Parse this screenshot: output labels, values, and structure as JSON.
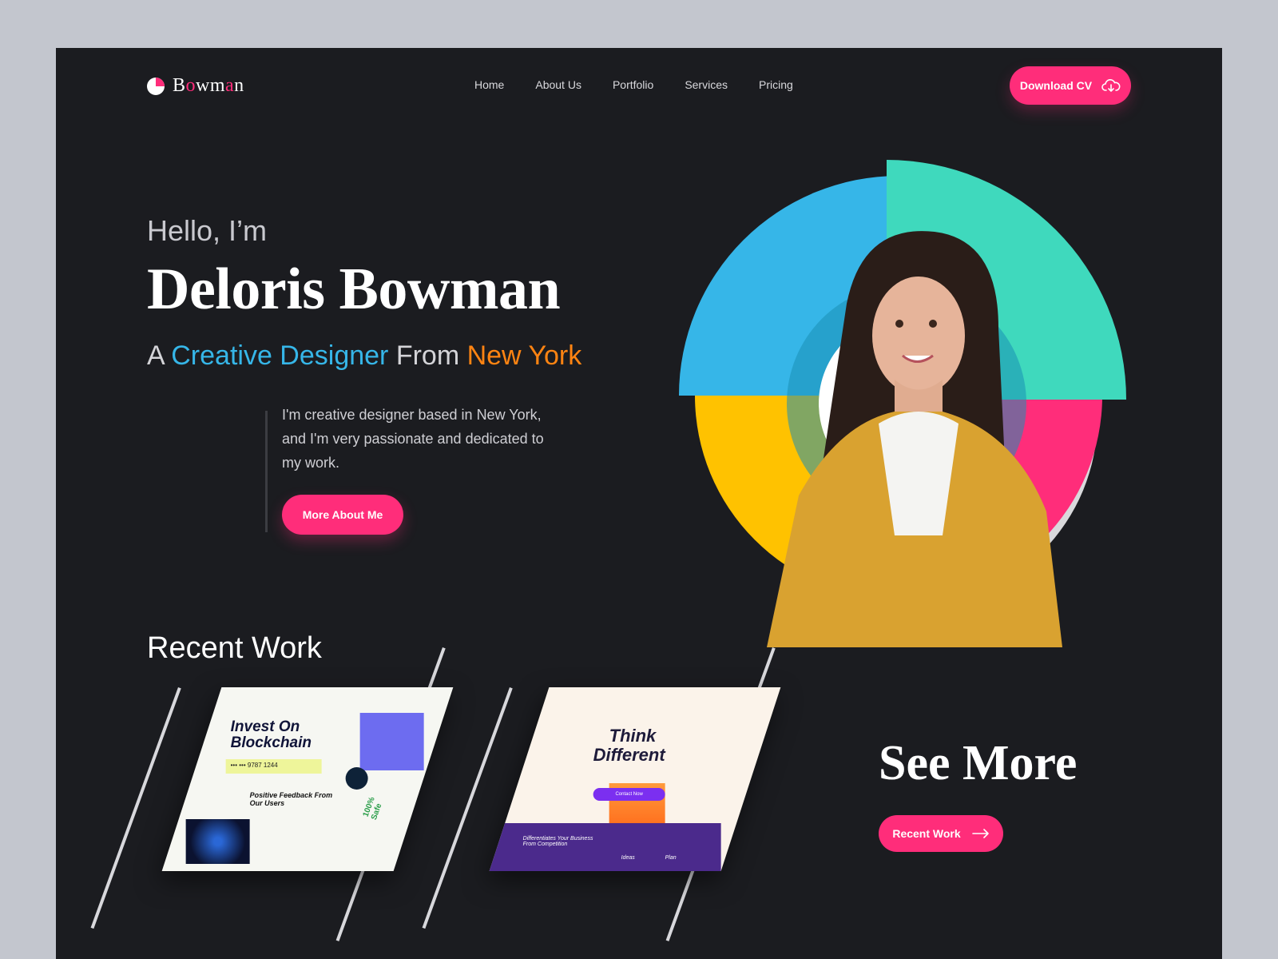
{
  "brand": {
    "logo_prefix": "B",
    "logo_o": "o",
    "logo_mid": "wm",
    "logo_a": "a",
    "logo_suffix": "n"
  },
  "nav": {
    "items": [
      "Home",
      "About Us",
      "Portfolio",
      "Services",
      "Pricing"
    ]
  },
  "header": {
    "download_label": "Download CV"
  },
  "hero": {
    "greeting": "Hello, I’m",
    "name": "Deloris Bowman",
    "tag_a": "A ",
    "tag_role": "Creative Designer",
    "tag_from": " From ",
    "tag_city": "New York",
    "intro": "I'm creative designer based in New York, and I'm very passionate and dedicated to my work.",
    "more_label": "More About Me"
  },
  "recent": {
    "title": "Recent Work",
    "card1": {
      "headline": "Invest On Blockchain",
      "code": "••• ••• 9787 1244",
      "feedback": "Positive Feedback From Our Users",
      "safe": "100% Safe"
    },
    "card2": {
      "headline_1": "Think",
      "headline_2": "Different",
      "cta": "Contact Now",
      "footer": "Differentiates Your Business From Competition",
      "tag_ideas": "Ideas",
      "tag_plan": "Plan"
    }
  },
  "see_more": {
    "title": "See More",
    "button_label": "Recent Work"
  },
  "colors": {
    "accent": "#ff2d7a",
    "blue": "#36b6e8",
    "orange": "#ff8412",
    "teal": "#3fd9bd",
    "yellow": "#ffc200",
    "bg": "#1b1c20"
  },
  "icons": {
    "download": "cloud-download-icon",
    "arrow": "arrow-right-icon"
  }
}
